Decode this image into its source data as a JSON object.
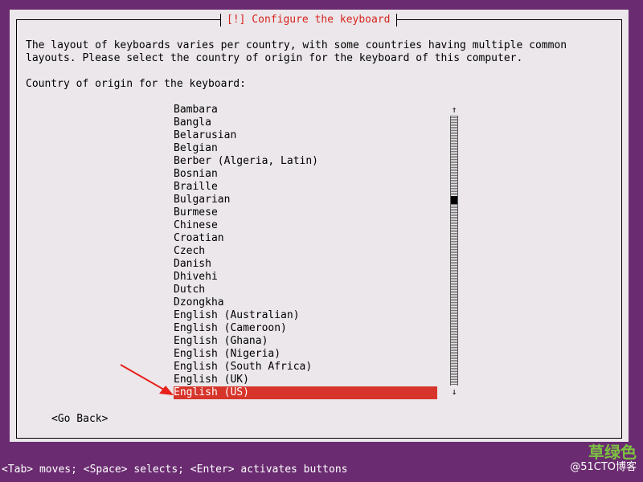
{
  "dialog": {
    "title": "[!] Configure the keyboard",
    "description": "The layout of keyboards varies per country, with some countries having multiple common\nlayouts. Please select the country of origin for the keyboard of this computer.",
    "prompt": "Country of origin for the keyboard:"
  },
  "list": {
    "items": [
      "Bambara",
      "Bangla",
      "Belarusian",
      "Belgian",
      "Berber (Algeria, Latin)",
      "Bosnian",
      "Braille",
      "Bulgarian",
      "Burmese",
      "Chinese",
      "Croatian",
      "Czech",
      "Danish",
      "Dhivehi",
      "Dutch",
      "Dzongkha",
      "English (Australian)",
      "English (Cameroon)",
      "English (Ghana)",
      "English (Nigeria)",
      "English (South Africa)",
      "English (UK)",
      "English (US)"
    ],
    "selected": "English (US)",
    "scroll_up_glyph": "↑",
    "scroll_down_glyph": "↓"
  },
  "buttons": {
    "go_back": "<Go Back>"
  },
  "status_bar": {
    "text": "<Tab> moves; <Space> selects; <Enter> activates buttons"
  },
  "watermark": {
    "line1": "草绿色",
    "line2": "@51CTO博客"
  },
  "colors": {
    "background": "#6a2b70",
    "dialog": "#ebe7ea",
    "title": "#d9231f",
    "selection": "#d7352b",
    "annotation_arrow": "#e8201a"
  }
}
